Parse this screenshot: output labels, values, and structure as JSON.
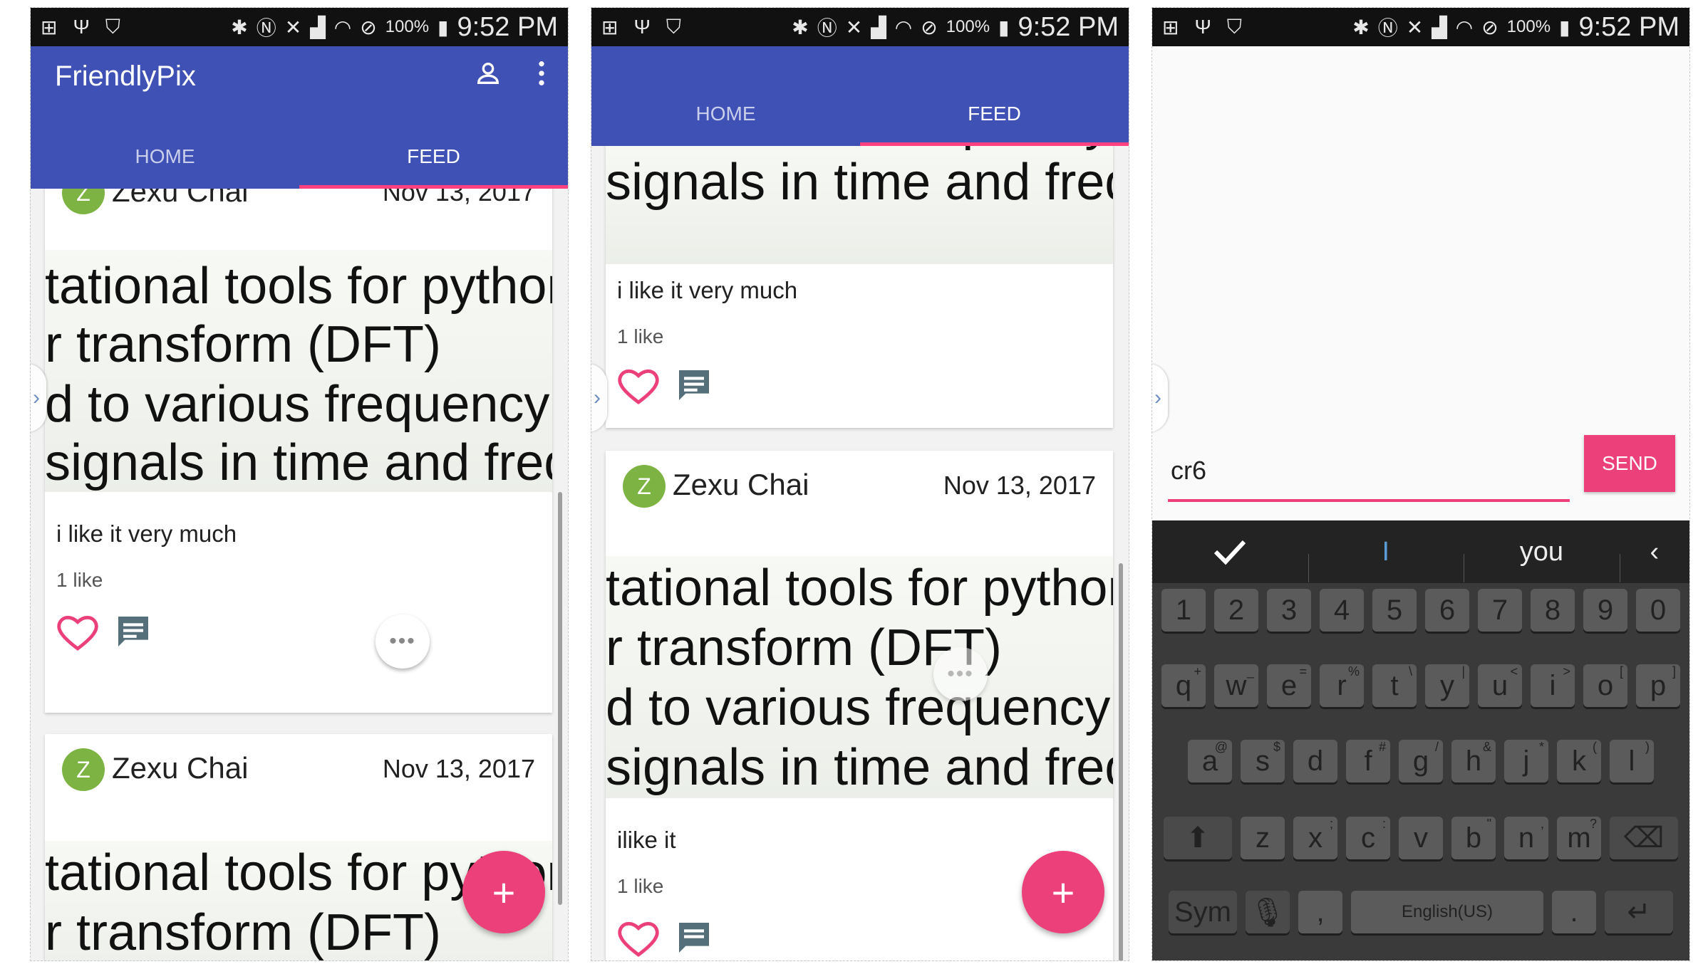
{
  "status": {
    "battery": "100%",
    "time": "9:52 PM"
  },
  "app": {
    "title": "FriendlyPix"
  },
  "tabs": {
    "home": "HOME",
    "feed": "FEED"
  },
  "post": {
    "author": "Zexu Chai",
    "avatar_letter": "Z",
    "date": "Nov 13, 2017",
    "image_lines": [
      "tational tools for python",
      "r transform (DFT)",
      "d to various frequency",
      "signals in time and freq"
    ],
    "comment1": "i like it very much",
    "comment2": "ilike it",
    "likes": "1 like"
  },
  "composer": {
    "input_value": "cr6",
    "send_label": "SEND"
  },
  "keyboard": {
    "suggestions": [
      "I",
      "you"
    ],
    "row_nums": [
      "1",
      "2",
      "3",
      "4",
      "5",
      "6",
      "7",
      "8",
      "9",
      "0"
    ],
    "row_q": [
      [
        "q",
        "+"
      ],
      [
        "w",
        "_"
      ],
      [
        "e",
        "="
      ],
      [
        "r",
        "%"
      ],
      [
        "t",
        "\\"
      ],
      [
        "y",
        "|"
      ],
      [
        "u",
        "<"
      ],
      [
        "i",
        ">"
      ],
      [
        "o",
        "["
      ],
      [
        "p",
        "]"
      ]
    ],
    "row_a": [
      [
        "a",
        "@"
      ],
      [
        "s",
        "$"
      ],
      [
        "d",
        ""
      ],
      [
        "f",
        "#"
      ],
      [
        "g",
        "/"
      ],
      [
        "h",
        "&"
      ],
      [
        "j",
        "*"
      ],
      [
        "k",
        "("
      ],
      [
        "l",
        ")"
      ]
    ],
    "row_z": [
      [
        "z",
        ""
      ],
      [
        "x",
        ";"
      ],
      [
        "c",
        ":"
      ],
      [
        "v",
        ""
      ],
      [
        "b",
        "\""
      ],
      [
        "n",
        ","
      ],
      [
        "m",
        "?"
      ]
    ],
    "sym": "Sym",
    "comma": ",",
    "space_label": "English(US)",
    "period": "."
  },
  "colors": {
    "primary": "#3f51b5",
    "accent": "#ff4081",
    "fab": "#ec407a",
    "avatar": "#7cb342"
  }
}
